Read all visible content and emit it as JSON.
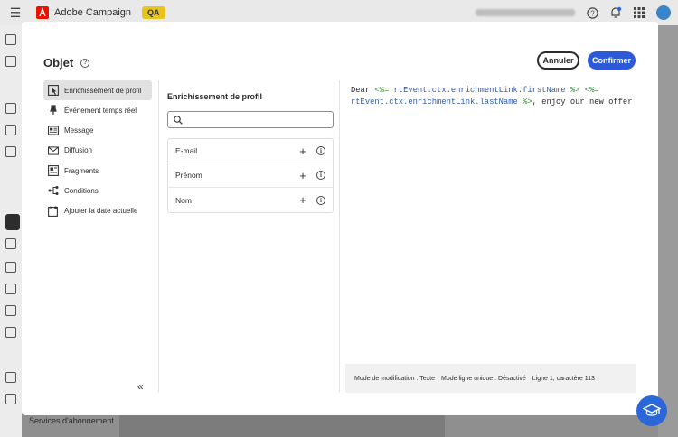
{
  "app": {
    "name": "Adobe Campaign",
    "env_badge": "QA",
    "org_name": "",
    "bottom_link": "Services d'abonnement"
  },
  "modal": {
    "title": "Objet",
    "cancel_label": "Annuler",
    "confirm_label": "Confirmer"
  },
  "nav": {
    "items": [
      {
        "label": "Enrichissement de profil",
        "icon": "cursor-icon",
        "active": true
      },
      {
        "label": "Événement temps réel",
        "icon": "pin-icon",
        "active": false
      },
      {
        "label": "Message",
        "icon": "message-icon",
        "active": false
      },
      {
        "label": "Diffusion",
        "icon": "mail-icon",
        "active": false
      },
      {
        "label": "Fragments",
        "icon": "fragment-icon",
        "active": false
      },
      {
        "label": "Conditions",
        "icon": "branch-icon",
        "active": false
      },
      {
        "label": "Ajouter la date actuelle",
        "icon": "calendar-icon",
        "active": false
      }
    ]
  },
  "panel": {
    "title": "Enrichissement de profil",
    "search_placeholder": "",
    "fields": [
      {
        "label": "E-mail"
      },
      {
        "label": "Prénom"
      },
      {
        "label": "Nom"
      }
    ]
  },
  "editor": {
    "code_line1_a": "Dear ",
    "code_line1_tag_open": "<%=",
    "code_line1_var": " rtEvent.ctx.enrichmentLink.firstName ",
    "code_line1_tag_close": "%>",
    "code_line1_tag_open2": " <%=",
    "code_line2_var": "rtEvent.ctx.enrichmentLink.lastName ",
    "code_line2_tag_close": "%>",
    "code_line2_tail": ", enjoy our new offer",
    "status_mode": "Mode de modification : Texte",
    "status_single_line": "Mode ligne unique : Désactivé",
    "status_position": "Ligne 1, caractère 113"
  },
  "colors": {
    "accent": "#2c5ad6",
    "qa_badge": "#e8c41f",
    "code_tag": "#2f8a2f",
    "code_var": "#2c5bb0"
  }
}
